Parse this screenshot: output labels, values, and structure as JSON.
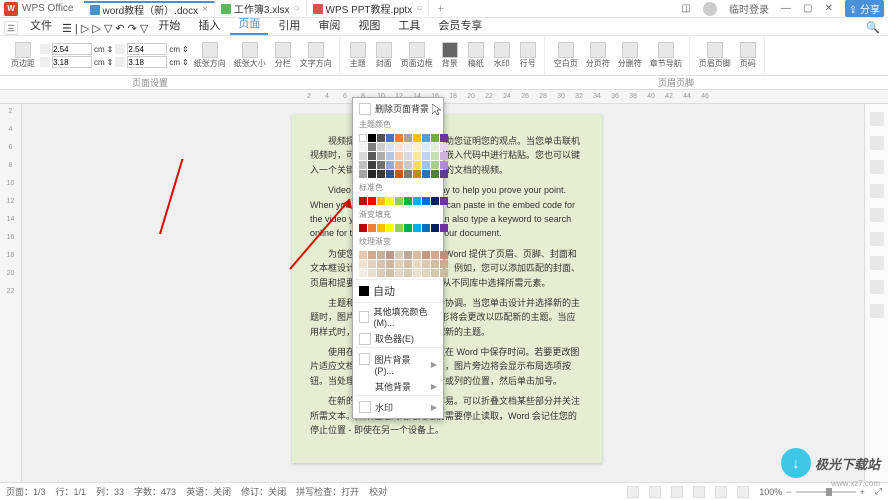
{
  "app": {
    "logo_letter": "W",
    "name": "WPS Office"
  },
  "tabs": [
    {
      "icon": "w",
      "label": "word教程（新）.docx",
      "active": true
    },
    {
      "icon": "s",
      "label": "工作簿3.xlsx",
      "active": false
    },
    {
      "icon": "p",
      "label": "WPS PPT教程.pptx",
      "active": false
    }
  ],
  "login": "临时登录",
  "share": "分享",
  "menu": [
    "三",
    "文件"
  ],
  "maintabs": [
    "开始",
    "插入",
    "页面",
    "引用",
    "审阅",
    "视图",
    "工具",
    "会员专享"
  ],
  "ribbon_active": "页面",
  "margin": {
    "top": "2.54",
    "bottom": "3.18",
    "unit": "cm"
  },
  "margin2": {
    "top": "2.54",
    "bottom": "3.18",
    "unit": "cm"
  },
  "ribbon_btns": [
    "页边距",
    "纸张方向",
    "纸张大小",
    "分栏",
    "文字方向",
    "主题",
    "封面",
    "页面边框",
    "背景",
    "稿纸",
    "水印",
    "行号",
    "空白页",
    "分页符",
    "分删符",
    "章节导航",
    "页眉页脚",
    "页码"
  ],
  "sublabels": {
    "left": "页面设置",
    "right": "页眉页脚"
  },
  "ruler": [
    "2",
    "4",
    "6",
    "8",
    "10",
    "12",
    "14",
    "16",
    "18",
    "20",
    "22",
    "24",
    "26",
    "28",
    "30",
    "32",
    "34",
    "36",
    "38",
    "40",
    "42",
    "44",
    "46"
  ],
  "vruler": [
    "2",
    "4",
    "6",
    "8",
    "10",
    "12",
    "14",
    "16",
    "18",
    "20",
    "22"
  ],
  "dropdown": {
    "remove": "删除页面背景",
    "theme_label": "主题颜色",
    "std_label": "标准色",
    "grad_label": "渐变填充",
    "texture_label": "纹理渐变",
    "auto": "自动",
    "more": "其他填充颜色(M)...",
    "eyedrop": "取色器(E)",
    "picbg": "图片背景(P)...",
    "otherbg": "其他背景",
    "waterm": "水印"
  },
  "doc": [
    "视频提供了功能强大的方法帮助您证明您的观点。当您单击联机视频时，可以在想要添加的视频的嵌入代码中进行粘贴。您也可以键入一个关键字以联机搜索最适合您的文档的视频。",
    "Video provides a powerful way to help you prove your point. When you click Online Video, you can paste in the embed code for the video you want to add. You can also type a keyword to search online for the video that best fits your document.",
    "为使您的文档具有专业外观，Word 提供了页眉、页脚、封面和文本框设计。这些设计可互为补充。例如，您可以添加匹配的封面、页眉和提要栏。单击\"插入\"，然后从不同库中选择所需元素。",
    "主题和样式也有助于文档保持协调。当您单击设计并选择新的主题时，图片、图表或 SmartArt 图形将会更改以匹配新的主题。当应用样式时，您的标题会更改以匹配新的主题。",
    "使用在需要位置出现的新按钮在 Word 中保存时间。若要更改图片适应文档的方式，请单击该图片，图片旁边将会显示布局选项按钮。当处理表格时，单击要添加行或列的位置，然后单击加号。",
    "在新的阅读视图中阅读更加容易。可以折叠文档某些部分并关注所需文本。如果在达到结尾处之前需要停止读取，Word 会记住您的停止位置 - 即使在另一个设备上。"
  ],
  "status": {
    "page": "页面：1/3",
    "line": "行：1/1",
    "col": "列：33",
    "chars": "字数：473",
    "lang": "英语：关闭",
    "edit": "修订：关闭",
    "spell": "拼写检查：打开",
    "proof": "校对",
    "zoom": "100%"
  },
  "watermark": {
    "text": "极光下载站",
    "url": "www.xz7.com"
  }
}
